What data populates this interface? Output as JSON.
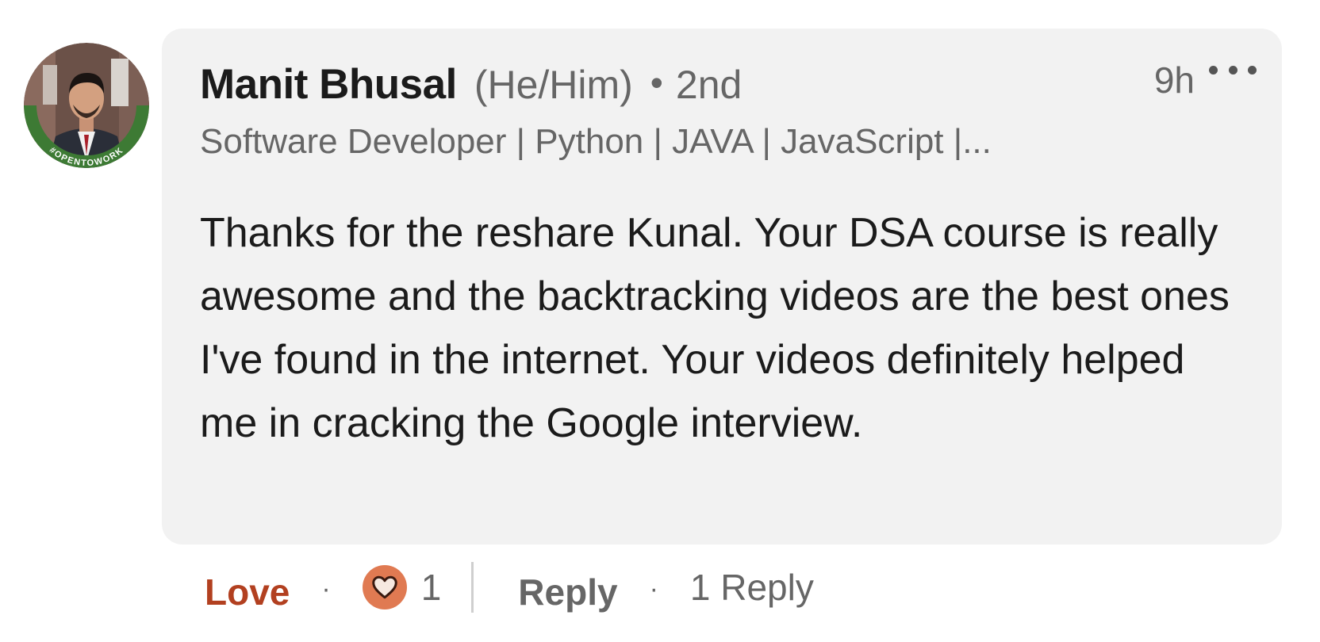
{
  "comment": {
    "author": {
      "name": "Manit Bhusal",
      "pronouns": "(He/Him)",
      "separator": "•",
      "connection_degree": "2nd",
      "headline": "Software Developer | Python | JAVA | JavaScript |...",
      "avatar_badge": "#OPENTOWORK"
    },
    "timestamp": "9h",
    "more_icon": "more-horizontal-icon",
    "body": "Thanks for the reshare Kunal. Your DSA course is really awesome and the backtracking videos are the best ones I've found in the internet. Your videos definitely helped me in cracking the Google interview."
  },
  "actions": {
    "reaction_label": "Love",
    "separator": "·",
    "reaction_icon": "heart-icon",
    "reaction_count": "1",
    "reply_label": "Reply",
    "replies_link": "1 Reply"
  },
  "colors": {
    "bubble_bg": "#f2f2f2",
    "love_text": "#b24020",
    "heart_badge": "#e07a52",
    "open_to_work_ring": "#3d7a34",
    "secondary_text": "#666666"
  }
}
